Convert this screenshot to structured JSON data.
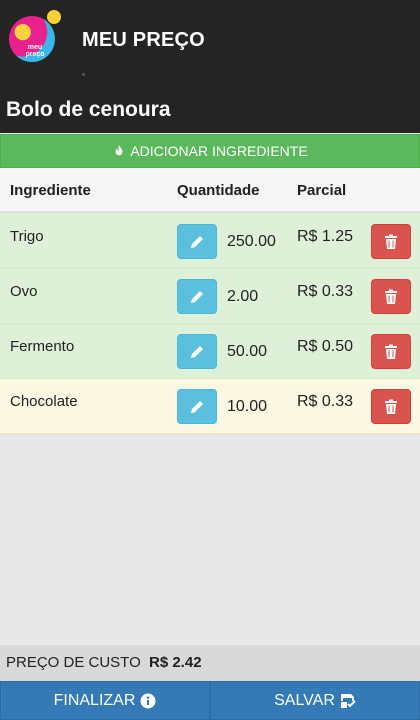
{
  "app": {
    "title": "MEU PREÇO",
    "logo_text": "meu preço"
  },
  "recipe": {
    "name": "Bolo de cenoura"
  },
  "actions": {
    "add_label": "ADICIONAR INGREDIENTE",
    "finalize_label": "FINALIZAR",
    "save_label": "SALVAR"
  },
  "table": {
    "headers": {
      "ingredient": "Ingrediente",
      "quantity": "Quantidade",
      "partial": "Parcial"
    },
    "rows": [
      {
        "name": "Trigo",
        "quantity": "250.00",
        "partial": "R$ 1.25",
        "status": "green"
      },
      {
        "name": "Ovo",
        "quantity": "2.00",
        "partial": "R$ 0.33",
        "status": "green"
      },
      {
        "name": "Fermento",
        "quantity": "50.00",
        "partial": "R$ 0.50",
        "status": "green"
      },
      {
        "name": "Chocolate",
        "quantity": "10.00",
        "partial": "R$ 0.33",
        "status": "yellow"
      }
    ]
  },
  "cost": {
    "label": "PREÇO DE CUSTO",
    "value": "R$ 2.42"
  },
  "icons": {
    "add": "fire-icon",
    "edit": "pencil-icon",
    "delete": "trash-icon",
    "finalize": "info-circle-icon",
    "save": "save-check-icon"
  },
  "colors": {
    "success": "#5cb85c",
    "info": "#5bc0de",
    "danger": "#d9534f",
    "primary": "#337ab7",
    "appbar": "#242424"
  }
}
